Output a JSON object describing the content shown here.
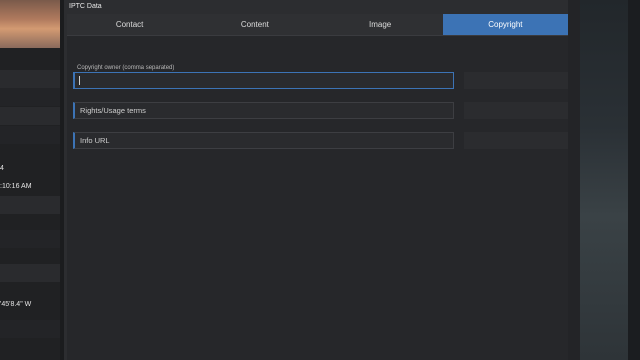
{
  "backdrop": {
    "left_values": [
      "4",
      ":10:16 AM",
      "'45'8.4\" W"
    ]
  },
  "dialog": {
    "title": "IPTC Data",
    "tabs": [
      {
        "label": "Contact",
        "active": false
      },
      {
        "label": "Content",
        "active": false
      },
      {
        "label": "Image",
        "active": false
      },
      {
        "label": "Copyright",
        "active": true
      }
    ],
    "fields": {
      "copyright_owner": {
        "label": "Copyright owner (comma separated)",
        "value": ""
      },
      "rights_usage": {
        "placeholder": "Rights/Usage terms"
      },
      "info_url": {
        "placeholder": "Info URL"
      }
    }
  },
  "colors": {
    "accent": "#3c73b5",
    "dialog_bg": "#2c2d30",
    "content_bg": "#26272a"
  }
}
